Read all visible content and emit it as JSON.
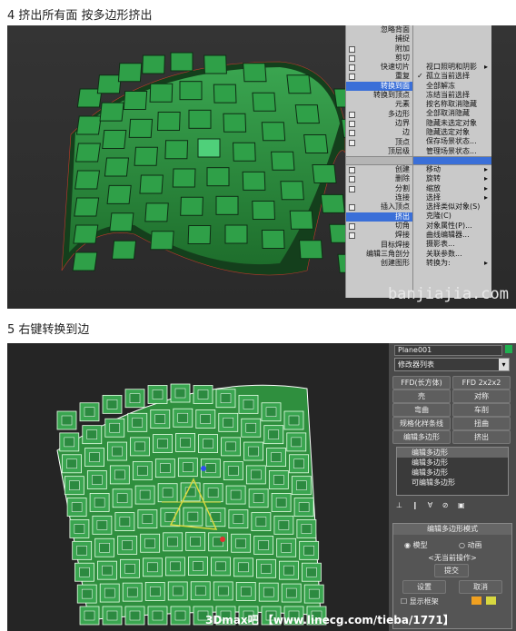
{
  "caption1": "4 挤出所有面 按多边形挤出",
  "caption2": "5 右键转换到边",
  "quad_left": [
    "忽略背面",
    "捕捉",
    "附加",
    "剪切",
    "快速切片",
    "重复",
    "转换到面",
    "转换到顶点",
    "元素",
    "多边形",
    "边界",
    "边",
    "顶点",
    "顶层级"
  ],
  "quad_left_bottom": [
    "创建",
    "删除",
    "分割",
    "连接",
    "插入顶点",
    "挤出",
    "切角",
    "焊接",
    "目标焊接",
    "编辑三角剖分",
    "创建图形"
  ],
  "quad_right": [
    "视口照明和阴影",
    "孤立当前选择",
    "全部解冻",
    "冻结当前选择",
    "按名称取消隐藏",
    "全部取消隐藏",
    "隐藏未选定对象",
    "隐藏选定对象",
    "保存场景状态...",
    "管理场景状态..."
  ],
  "quad_right_bottom": [
    "移动",
    "旋转",
    "缩放",
    "选择",
    "选择类似对象(S)",
    "克隆(C)",
    "对象属性(P)...",
    "曲线编辑器...",
    "摄影表...",
    "关联参数...",
    "转换为:"
  ],
  "watermark1": "banjiajia.com",
  "side": {
    "object_name": "Plane001",
    "modifier_list": "修改器列表",
    "buttons": [
      "FFD(长方体)",
      "FFD 2x2x2",
      "壳",
      "对称",
      "弯曲",
      "车削",
      "规格化样条线",
      "扭曲",
      "编辑多边形",
      "挤出"
    ],
    "stack": [
      "编辑多边形",
      "编辑多边形",
      "编辑多边形",
      "可编辑多边形"
    ],
    "rollout_title": "编辑多边形模式",
    "mode_model": "模型",
    "mode_anim": "动画",
    "no_op": "<无当前操作>",
    "commit": "提交",
    "settings": "设置",
    "cancel": "取消",
    "show_cage": "显示框架"
  },
  "watermark2": "3Dmax吧 【www.linecg.com/tieba/1771】",
  "colors": {
    "mesh_green": "#2f8f3e",
    "highlight": "#3a6fd8",
    "cage_orange": "#f0a020",
    "cage_yellow": "#d8d840"
  }
}
